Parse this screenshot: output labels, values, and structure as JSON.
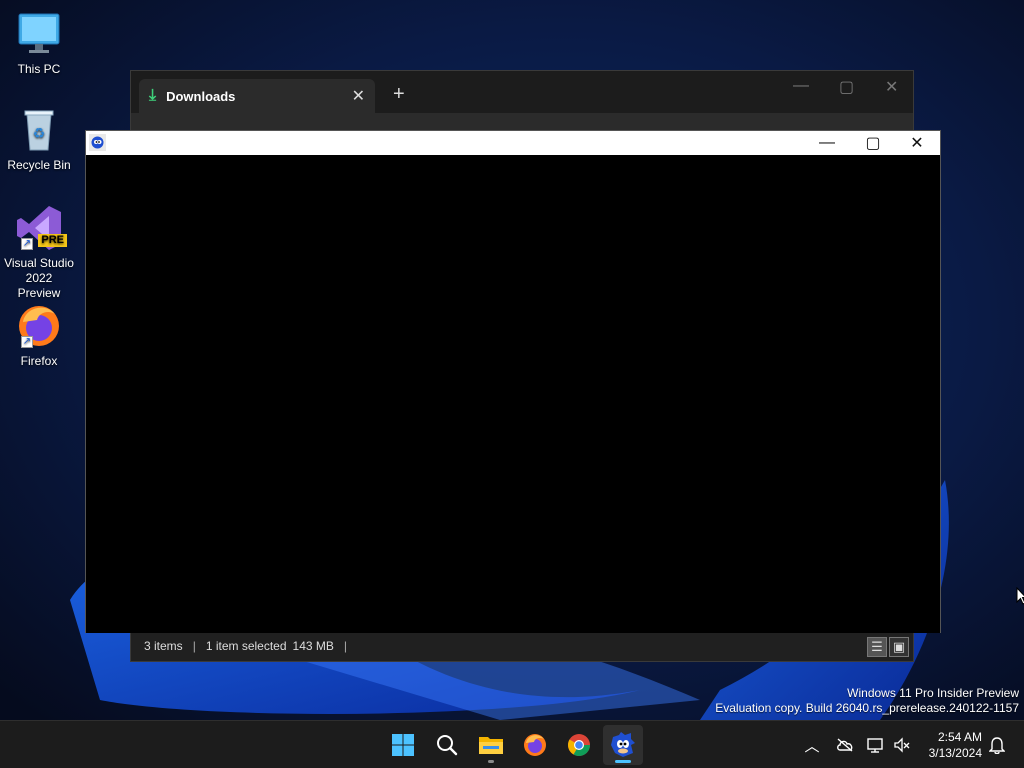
{
  "desktop": {
    "icons": [
      {
        "label": "This PC",
        "icon": "monitor-icon"
      },
      {
        "label": "Recycle Bin",
        "icon": "recycle-bin-icon"
      },
      {
        "label": "Visual Studio 2022 Preview",
        "icon": "visual-studio-icon",
        "badge": "PRE"
      },
      {
        "label": "Firefox",
        "icon": "firefox-icon"
      }
    ]
  },
  "explorer": {
    "tab_label": "Downloads",
    "status": {
      "items": "3 items",
      "selected": "1 item selected",
      "size": "143 MB"
    }
  },
  "game_window": {
    "title": "",
    "icon": "sonic-icon"
  },
  "watermark": {
    "line1": "Windows 11 Pro Insider Preview",
    "line2": "Evaluation copy. Build 26040.rs_prerelease.240122-1157"
  },
  "taskbar": {
    "apps": [
      "start-icon",
      "search-icon",
      "file-explorer-icon",
      "firefox-icon",
      "chrome-icon",
      "sonic-icon"
    ],
    "active_app": "sonic-icon",
    "time": "2:54 AM",
    "date": "3/13/2024"
  },
  "colors": {
    "accent": "#4cc2ff",
    "titlebar": "#ffffff",
    "taskbar": "#1c1c1c"
  }
}
